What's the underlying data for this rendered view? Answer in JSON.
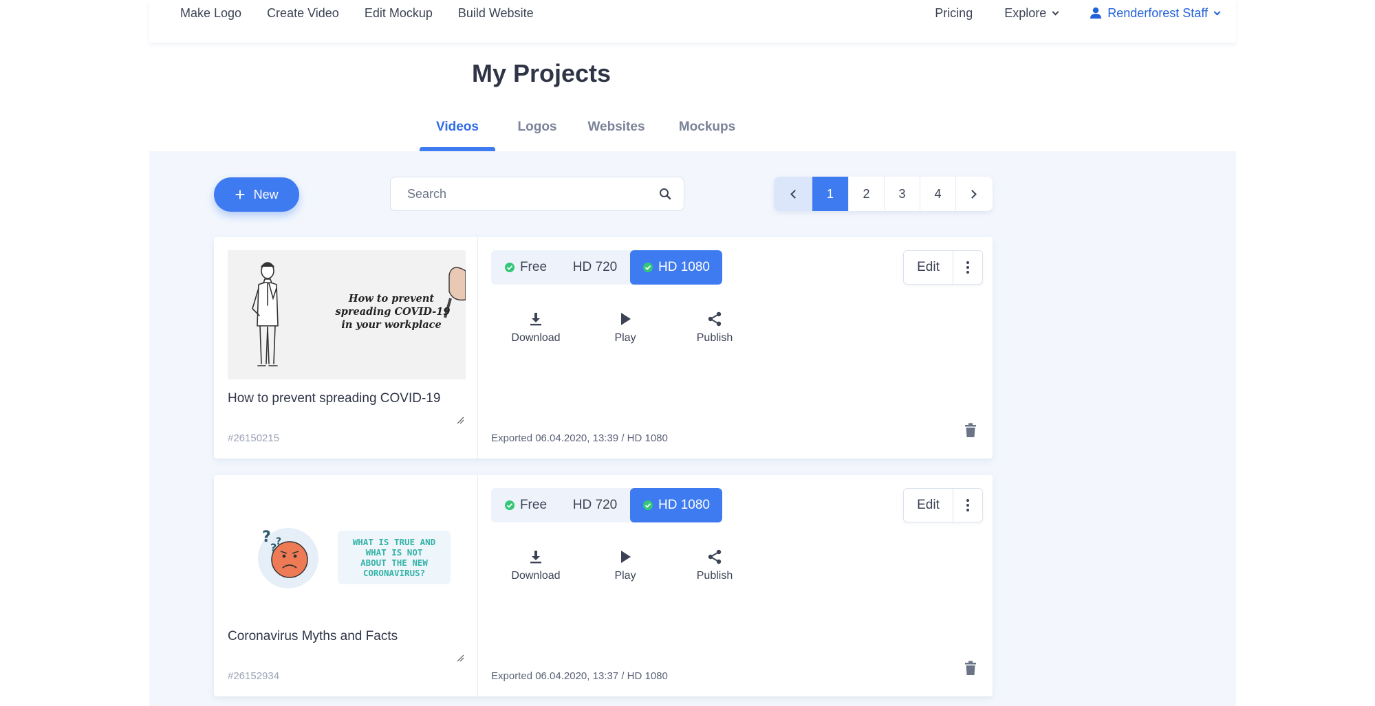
{
  "nav": {
    "left": [
      "Make Logo",
      "Create Video",
      "Edit Mockup",
      "Build Website"
    ],
    "pricing": "Pricing",
    "explore": "Explore",
    "user": "Renderforest Staff"
  },
  "page_title": "My Projects",
  "tabs": [
    "Videos",
    "Logos",
    "Websites",
    "Mockups"
  ],
  "toolbar": {
    "new_label": "New",
    "search_placeholder": "Search"
  },
  "pagination": {
    "pages": [
      "1",
      "2",
      "3",
      "4"
    ],
    "current": "1"
  },
  "quality_options": [
    "Free",
    "HD 720",
    "HD 1080"
  ],
  "actions": {
    "download": "Download",
    "play": "Play",
    "publish": "Publish"
  },
  "edit_label": "Edit",
  "projects": [
    {
      "name": "How to prevent spreading COVID-19",
      "id": "#26150215",
      "exported": "Exported 06.04.2020, 13:39 / HD 1080",
      "thumb_text": [
        "How to prevent",
        "spreading COVID-19",
        "in your workplace"
      ]
    },
    {
      "name": "Coronavirus Myths and Facts",
      "id": "#26152934",
      "exported": "Exported 06.04.2020, 13:37 / HD 1080",
      "thumb_text": [
        "WHAT IS TRUE AND",
        "WHAT IS NOT",
        "ABOUT THE NEW",
        "CORONAVIRUS?"
      ]
    }
  ],
  "colors": {
    "accent": "#3f7bf0",
    "user_link": "#2361d9",
    "page_bg": "#f3f7fd",
    "check_green": "#34c777"
  }
}
